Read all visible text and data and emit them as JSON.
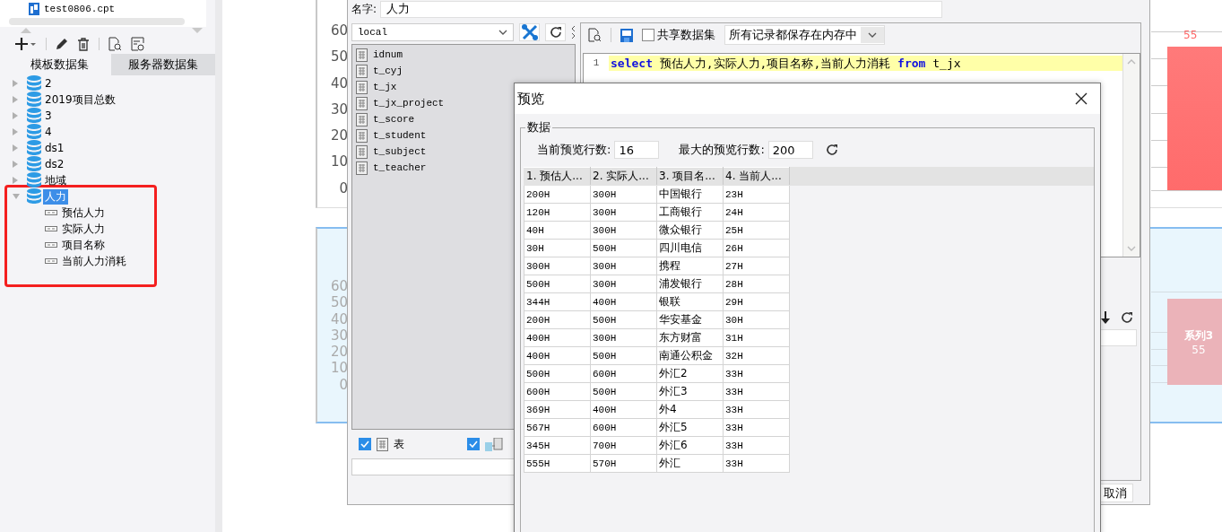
{
  "sidebar": {
    "file_item": "test0806.cpt",
    "tabs": [
      {
        "label": "模板数据集",
        "selected": true
      },
      {
        "label": "服务器数据集",
        "selected": false
      }
    ],
    "datasets": [
      {
        "name": "2",
        "expanded": false,
        "selected": false,
        "highlighted": false
      },
      {
        "name": "2019项目总数",
        "expanded": false,
        "selected": false,
        "highlighted": false
      },
      {
        "name": "3",
        "expanded": false,
        "selected": false,
        "highlighted": false
      },
      {
        "name": "4",
        "expanded": false,
        "selected": false,
        "highlighted": false
      },
      {
        "name": "ds1",
        "expanded": false,
        "selected": false,
        "highlighted": false
      },
      {
        "name": "ds2",
        "expanded": false,
        "selected": false,
        "highlighted": false
      },
      {
        "name": "地域",
        "expanded": false,
        "selected": false,
        "highlighted": false
      },
      {
        "name": "人力",
        "expanded": true,
        "selected": true,
        "highlighted": true,
        "children": [
          {
            "name": "预估人力"
          },
          {
            "name": "实际人力"
          },
          {
            "name": "项目名称"
          },
          {
            "name": "当前人力消耗"
          }
        ]
      }
    ]
  },
  "chart_top": {
    "axis_labels": [
      "60",
      "50",
      "40",
      "30",
      "20",
      "10",
      "0"
    ],
    "bar_value": "55"
  },
  "chart_bottom": {
    "axis_labels": [
      "60",
      "50",
      "40",
      "30",
      "20",
      "10",
      "0"
    ],
    "bar_series": "系列3",
    "bar_value": "55"
  },
  "dataset_dialog": {
    "name_label": "名字:",
    "name_value": "人力",
    "connection": "local",
    "tables": [
      "idnum",
      "t_cyj",
      "t_jx",
      "t_jx_project",
      "t_score",
      "t_student",
      "t_subject",
      "t_teacher"
    ],
    "filters": [
      {
        "label": "表",
        "checked": true,
        "kind": "table"
      },
      {
        "checked": true,
        "kind": "view"
      }
    ],
    "shared_dataset": {
      "label": "共享数据集",
      "checked": false
    },
    "storage_mode": "所有记录都保存在内存中",
    "sql": {
      "line_number": "1",
      "tokens": [
        {
          "text": "select",
          "kind": "keyword"
        },
        {
          "text": "预估人力,实际人力,项目名称,当前人力消耗",
          "kind": "plain"
        },
        {
          "text": "from",
          "kind": "keyword"
        },
        {
          "text": "t_jx",
          "kind": "plain"
        }
      ]
    },
    "cancel_button": "取消"
  },
  "preview_dialog": {
    "title": "预览",
    "group": "数据",
    "current_rows_label": "当前预览行数:",
    "current_rows": "16",
    "max_rows_label": "最大的预览行数:",
    "max_rows": "200",
    "columns": [
      "1. 预估人...",
      "2. 实际人...",
      "3. 项目名...",
      "4. 当前人..."
    ],
    "rows": [
      [
        "200H",
        "300H",
        "中国银行",
        "23H"
      ],
      [
        "120H",
        "300H",
        "工商银行",
        "24H"
      ],
      [
        "40H",
        "300H",
        "微众银行",
        "25H"
      ],
      [
        "30H",
        "500H",
        "四川电信",
        "26H"
      ],
      [
        "300H",
        "300H",
        "携程",
        "27H"
      ],
      [
        "500H",
        "300H",
        "浦发银行",
        "28H"
      ],
      [
        "344H",
        "400H",
        "银联",
        "29H"
      ],
      [
        "200H",
        "500H",
        "华安基金",
        "30H"
      ],
      [
        "400H",
        "300H",
        "东方财富",
        "31H"
      ],
      [
        "400H",
        "500H",
        "南通公积金",
        "32H"
      ],
      [
        "500H",
        "600H",
        "外汇2",
        "33H"
      ],
      [
        "600H",
        "500H",
        "外汇3",
        "33H"
      ],
      [
        "369H",
        "400H",
        "外4",
        "33H"
      ],
      [
        "567H",
        "600H",
        "外汇5",
        "33H"
      ],
      [
        "345H",
        "700H",
        "外汇6",
        "33H"
      ],
      [
        "555H",
        "570H",
        "外汇",
        "33H"
      ]
    ]
  }
}
